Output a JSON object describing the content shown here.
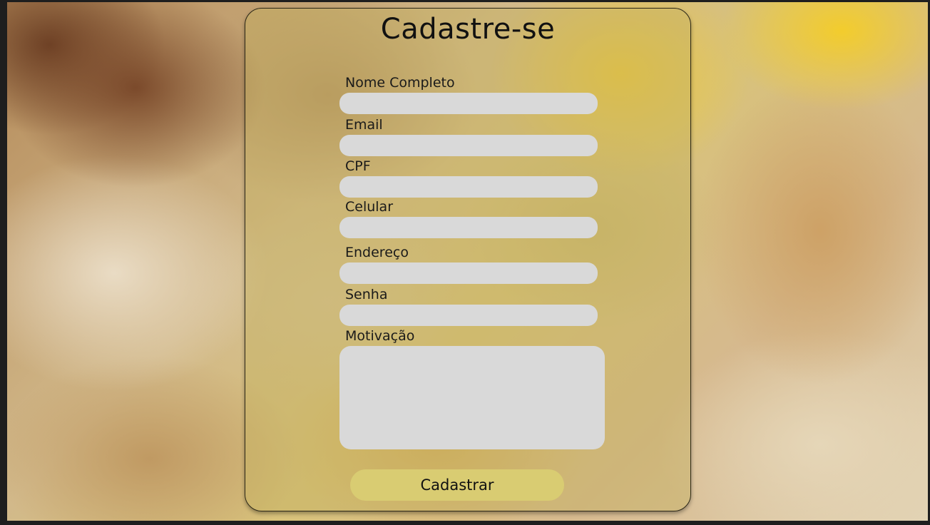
{
  "form": {
    "title": "Cadastre-se",
    "fields": [
      {
        "label": "Nome Completo",
        "value": "",
        "placeholder": ""
      },
      {
        "label": "Email",
        "value": "",
        "placeholder": ""
      },
      {
        "label": "CPF",
        "value": "",
        "placeholder": ""
      },
      {
        "label": "Celular",
        "value": "",
        "placeholder": ""
      },
      {
        "label": "Endereço",
        "value": "",
        "placeholder": ""
      },
      {
        "label": "Senha",
        "value": "",
        "placeholder": ""
      }
    ],
    "motivation": {
      "label": "Motivação",
      "value": "",
      "placeholder": ""
    },
    "submit_label": "Cadastrar"
  },
  "colors": {
    "card_tint": "#c4b05c",
    "input_bg": "#d9d9d9",
    "button_bg": "#d9cc72"
  }
}
